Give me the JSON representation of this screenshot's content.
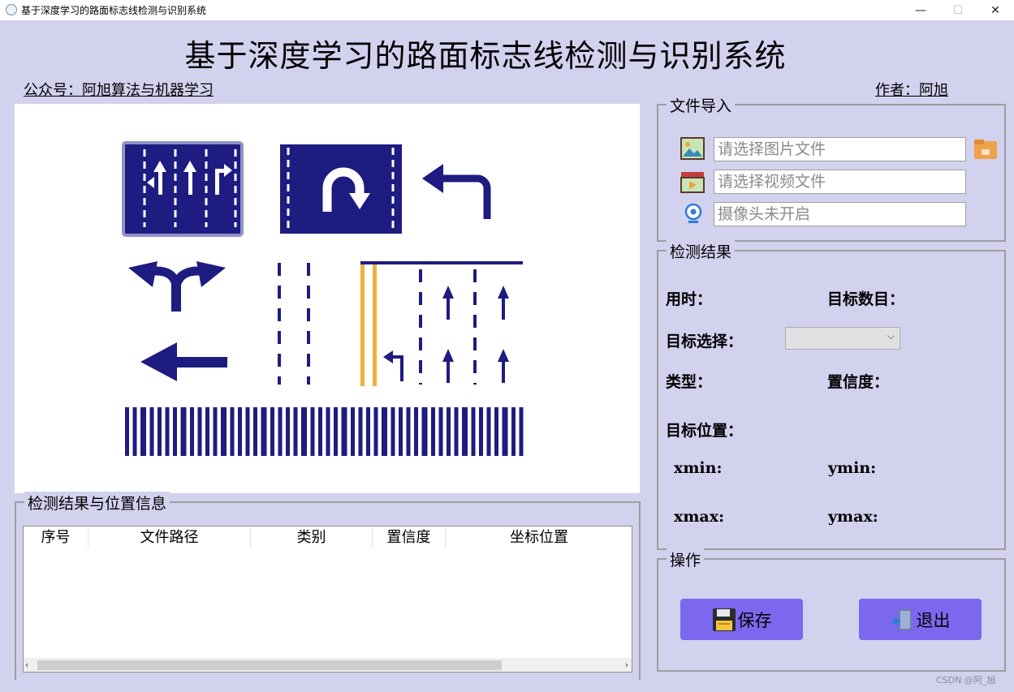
{
  "window": {
    "title": "基于深度学习的路面标志线检测与识别系统",
    "minimize": "—",
    "maximize": "☐",
    "close": "✕"
  },
  "header": {
    "title": "基于深度学习的路面标志线检测与识别系统",
    "left_link": "公众号：阿旭算法与机器学习",
    "right_link": "作者：阿旭"
  },
  "file_import": {
    "title": "文件导入",
    "image_placeholder": "请选择图片文件",
    "video_placeholder": "请选择视频文件",
    "camera_placeholder": "摄像头未开启",
    "icons": [
      "image-file-icon",
      "video-file-icon",
      "webcam-icon",
      "folder-icon"
    ]
  },
  "detection": {
    "title": "检测结果",
    "time_label": "用时：",
    "count_label": "目标数目：",
    "select_label": "目标选择：",
    "select_value": "",
    "type_label": "类型：",
    "conf_label": "置信度：",
    "position_label": "目标位置：",
    "xmin_label": "xmin:",
    "ymin_label": "ymin:",
    "xmax_label": "xmax:",
    "ymax_label": "ymax:"
  },
  "operations": {
    "title": "操作",
    "save_label": "保存",
    "exit_label": "退出"
  },
  "results_table": {
    "title": "检测结果与位置信息",
    "columns": [
      "序号",
      "文件路径",
      "类别",
      "置信度",
      "坐标位置"
    ],
    "rows": []
  },
  "watermark": "CSDN @阿_旭",
  "colors": {
    "background": "#d2d1ee",
    "button": "#7b68ee",
    "road_mark_blue": "#1e1c80",
    "lane_yellow": "#f0b040"
  }
}
